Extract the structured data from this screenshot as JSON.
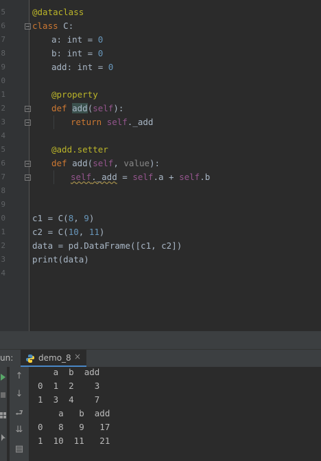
{
  "editor": {
    "line_numbers": [
      "5",
      "6",
      "7",
      "8",
      "9",
      "0",
      "1",
      "2",
      "3",
      "4",
      "5",
      "6",
      "7",
      "8",
      "9",
      "0",
      "1",
      "2",
      "3",
      "4"
    ],
    "lines": {
      "l1_dec": "@dataclass",
      "l2_kw": "class",
      "l2_rest": " C:",
      "l3_name": "a: ",
      "l3_type": "int",
      "l3_eq": " = ",
      "l3_num": "0",
      "l4_name": "b: ",
      "l4_type": "int",
      "l4_eq": " = ",
      "l4_num": "0",
      "l5_name": "add: ",
      "l5_type": "int",
      "l5_eq": " = ",
      "l5_num": "0",
      "l7_dec": "@property",
      "l8_kw": "def",
      "l8_sp": " ",
      "l8_fn": "add",
      "l8_paren": "(",
      "l8_self": "self",
      "l8_end": "):",
      "l9_kw": "return",
      "l9_sp": " ",
      "l9_self": "self",
      "l9_rest": "._add",
      "l11_dec": "@add.setter",
      "l12_kw": "def",
      "l12_rest": " add(",
      "l12_self": "self",
      "l12_comma": ", ",
      "l12_val": "value",
      "l12_end": "):",
      "l13_self": "self",
      "l13_attr": "._add",
      "l13_eq": " = ",
      "l13_self2": "self",
      "l13_a": ".a + ",
      "l13_self3": "self",
      "l13_b": ".b",
      "l16_a": "c1 = C(",
      "l16_n1": "8",
      "l16_c": ", ",
      "l16_n2": "9",
      "l16_e": ")",
      "l17_a": "c2 = C(",
      "l17_n1": "10",
      "l17_c": ", ",
      "l17_n2": "11",
      "l17_e": ")",
      "l18": "data = pd.DataFrame([c1, c2])",
      "l19": "print(data)"
    }
  },
  "run_panel": {
    "label": "un:",
    "tab_label": "demo_8",
    "close_glyph": "×"
  },
  "console": {
    "lines": [
      "   a  b  add",
      "0  1  2    3",
      "1  3  4    7",
      "    a   b  add",
      "0   8   9   17",
      "1  10  11   21"
    ]
  },
  "colors": {
    "background": "#2b2b2b",
    "keyword": "#cc7832",
    "number": "#6897bb",
    "decorator": "#bbb529",
    "self": "#94558d",
    "tab_underline": "#4a88c7"
  },
  "icons": {
    "run_tab": "python-icon",
    "toolbar": [
      "run-icon",
      "stop-icon",
      "layout-icon",
      "pin-icon",
      "up-arrow-icon",
      "down-arrow-icon",
      "soft-wrap-icon",
      "scroll-to-end-icon",
      "print-icon"
    ]
  }
}
